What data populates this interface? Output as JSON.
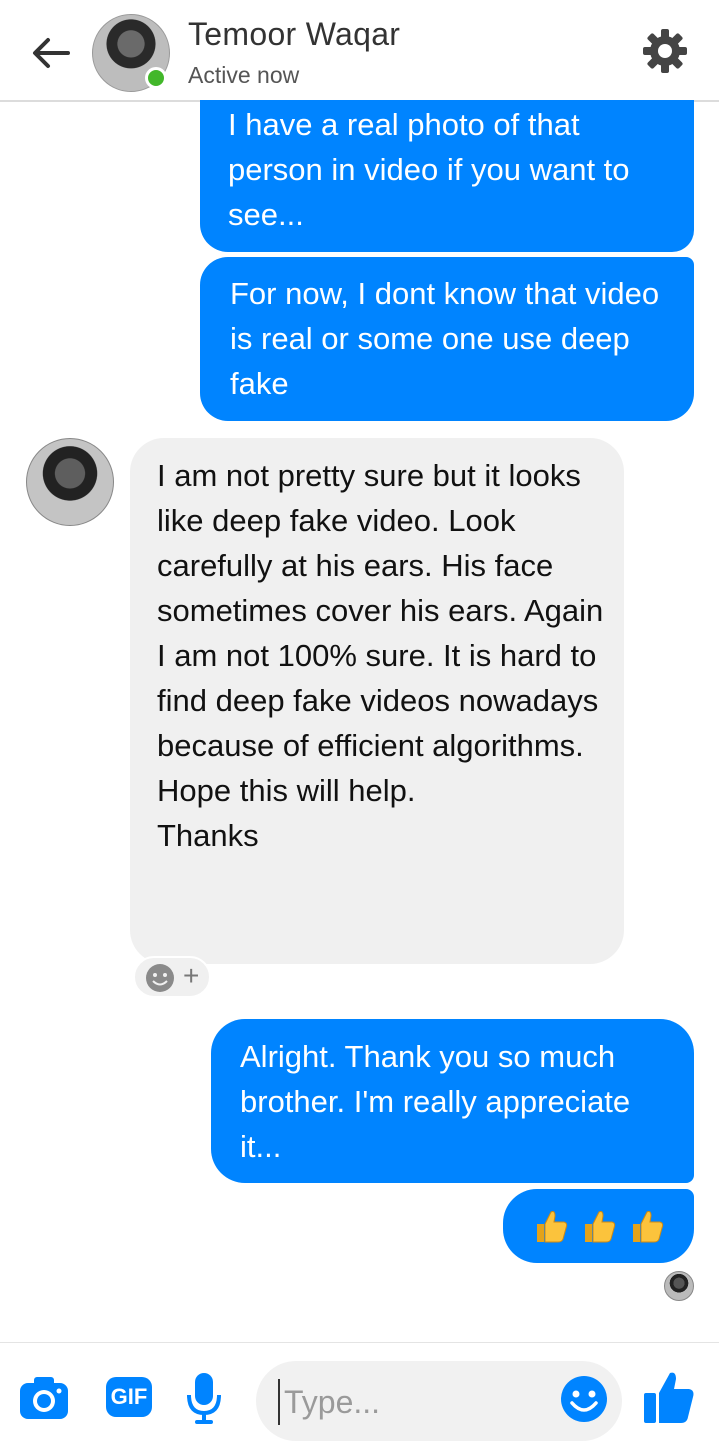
{
  "header": {
    "contact_name": "Temoor Waqar",
    "status": "Active now",
    "icons": [
      "back-arrow-icon",
      "gear-icon"
    ]
  },
  "messages": [
    {
      "direction": "outgoing",
      "text": "I have a real photo of that person in video if you want to see..."
    },
    {
      "direction": "outgoing",
      "text": "For now, I dont know that video is real or some one use deep fake"
    },
    {
      "direction": "incoming",
      "text": "I am not pretty sure but it looks like deep fake video. Look carefully at his ears. His face sometimes cover his ears. Again I am not 100% sure. It is hard to find deep fake videos nowadays because of efficient algorithms. Hope this will help.\nThanks"
    },
    {
      "direction": "outgoing",
      "text": "Alright. Thank you so much brother. I'm really appreciate it..."
    },
    {
      "direction": "outgoing",
      "emoji": [
        "thumbs-up",
        "thumbs-up",
        "thumbs-up"
      ]
    }
  ],
  "composer": {
    "placeholder": "Type...",
    "gif_label": "GIF",
    "icons": [
      "camera-icon",
      "gif-icon",
      "microphone-icon",
      "emoji-icon",
      "like-icon"
    ]
  },
  "colors": {
    "accent": "#0084ff",
    "incoming_bubble": "#f0f0f0",
    "online": "#42b72a"
  }
}
